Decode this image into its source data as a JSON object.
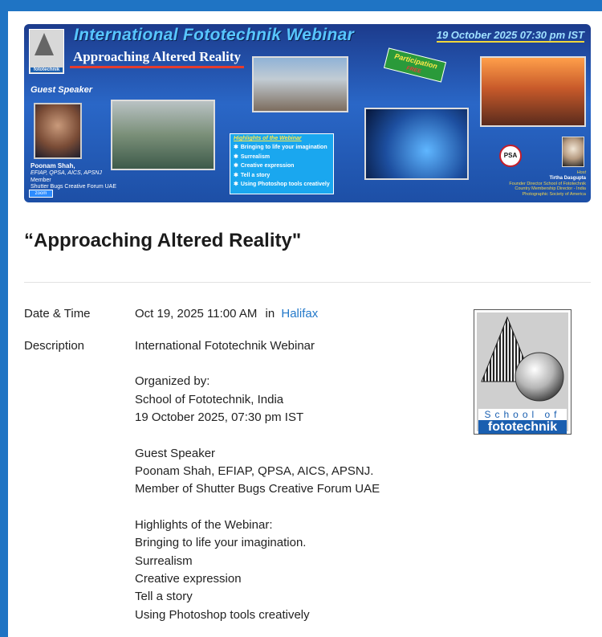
{
  "banner": {
    "title": "International Fototechnik Webinar",
    "subtitle": "Approaching Altered Reality",
    "date": "19 October 2025 07:30 pm IST",
    "logo_label": "fototechnik",
    "guest_label": "Guest Speaker",
    "speaker_name": "Poonam Shah,",
    "speaker_honors": "EFIAP, QPSA, AICS, APSNJ",
    "speaker_member": "Member",
    "speaker_forum": "Shutter Bugs Creative Forum UAE",
    "zoom_label": "zoom",
    "participation": "Participation",
    "participation_free": "FREE",
    "highlights_title": "Highlights of the Webinar",
    "highlights": [
      "Bringing to life your imagination",
      "Surrealism",
      "Creative expression",
      "Tell a story",
      "Using Photoshop tools creatively"
    ],
    "psa_label": "PSA",
    "host_role": "Host",
    "host_name": "Tirtha Dasgupta",
    "host_title1": "Founder Director School of Fototechnik",
    "host_title2": "Country Membership Director - India",
    "host_title3": "Photographic Society of America"
  },
  "event": {
    "title": "“Approaching Altered Reality\"",
    "datetime_label": "Date & Time",
    "datetime_value": "Oct 19, 2025 11:00 AM",
    "datetime_in": "in",
    "city": "Halifax",
    "description_label": "Description",
    "description_lines": {
      "l1": "International Fototechnik Webinar",
      "l2": "Organized by:",
      "l3": "School of Fototechnik, India",
      "l4": "19 October 2025, 07:30 pm IST",
      "l5": "Guest Speaker",
      "l6": "Poonam Shah, EFIAP, QPSA, AICS, APSNJ.",
      "l7": "Member of Shutter Bugs Creative Forum UAE",
      "l8": "Highlights of the Webinar:",
      "l9": "Bringing to life your imagination.",
      "l10": "Surrealism",
      "l11": "Creative expression",
      "l12": "Tell a story",
      "l13": "Using Photoshop tools creatively"
    }
  },
  "logo": {
    "school": "School of",
    "name": "fototechnik"
  },
  "colors": {
    "frame": "#1f74c4",
    "link": "#2278c9",
    "logo_blue": "#1a5fb0"
  }
}
